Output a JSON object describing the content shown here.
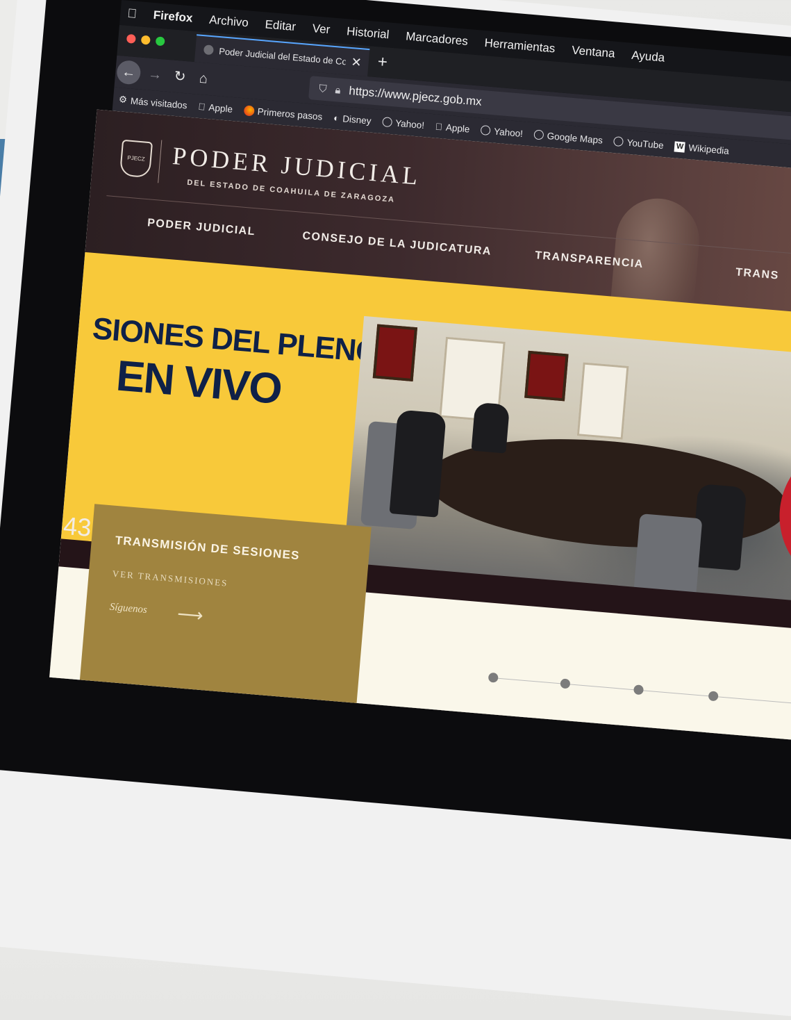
{
  "menubar": {
    "app": "Firefox",
    "items": [
      "Archivo",
      "Editar",
      "Ver",
      "Historial",
      "Marcadores",
      "Herramientas",
      "Ventana",
      "Ayuda"
    ]
  },
  "tab": {
    "title": "Poder Judicial del Estado de Co"
  },
  "url": "https://www.pjecz.gob.mx",
  "bookmarks": [
    "Más visitados",
    "Apple",
    "Primeros pasos",
    "Disney",
    "Yahoo!",
    "Apple",
    "Yahoo!",
    "Google Maps",
    "YouTube",
    "Wikipedia"
  ],
  "site": {
    "brand_title": "PODER JUDICIAL",
    "brand_subtitle": "DEL ESTADO DE COAHUILA DE ZARAGOZA",
    "logo_text": "PJECZ",
    "nav": [
      "PODER JUDICIAL",
      "CONSEJO DE LA JUDICATURA",
      "TRANSPARENCIA",
      "TRANS"
    ],
    "promo_line1": "SIONES DEL PLENO",
    "promo_line2": "EN VIVO",
    "counter": "43",
    "card_title": "TRANSMISIÓN DE SESIONES",
    "card_link": "VER TRANSMISIONES",
    "card_follow": "Síguenos"
  },
  "colors": {
    "promo_yellow": "#f8c93a",
    "promo_text": "#0f2148",
    "play_red": "#c8202c",
    "card_gold": "#a0843f",
    "header_dark": "#2c1f22"
  },
  "slider": {
    "dot_count": 4
  }
}
